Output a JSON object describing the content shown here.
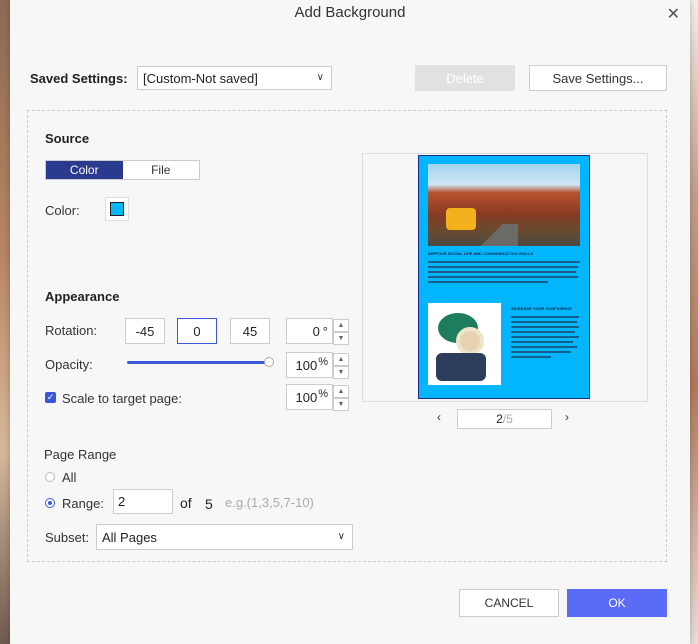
{
  "dialog": {
    "title": "Add Background"
  },
  "saved_settings": {
    "label": "Saved Settings:",
    "value": "[Custom-Not saved]",
    "delete_label": "Delete",
    "save_label": "Save Settings..."
  },
  "source": {
    "heading": "Source",
    "tabs": [
      "Color",
      "File"
    ],
    "active_tab": "Color",
    "color_label": "Color:",
    "color_value": "#00b7f7"
  },
  "appearance": {
    "heading": "Appearance",
    "rotation_label": "Rotation:",
    "rotation_options": [
      "-45",
      "0",
      "45"
    ],
    "rotation_selected": "0",
    "rotation_value": "0",
    "rotation_unit": "°",
    "opacity_label": "Opacity:",
    "opacity_value": "100",
    "opacity_unit": "%",
    "scale_label": "Scale to target page:",
    "scale_checked": true,
    "scale_value": "100",
    "scale_unit": "%"
  },
  "page_range": {
    "heading": "Page Range",
    "all_label": "All",
    "range_label": "Range:",
    "range_value": "2",
    "of_label": "of",
    "total_pages": "5",
    "example": "e.g.(1,3,5,7-10)",
    "subset_label": "Subset:",
    "subset_value": "All Pages"
  },
  "preview": {
    "prev_icon": "‹",
    "next_icon": "›",
    "current_page": "2",
    "total_suffix": "/5",
    "doc_heading1": "IMPROVE SOCIAL LIFE AND COMMUNICATION SKILLS",
    "doc_heading2": "INCREASE YOUR CONFIDENCE"
  },
  "footer": {
    "cancel_label": "CANCEL",
    "ok_label": "OK"
  },
  "colors": {
    "accent": "#5a6cf5",
    "segment_active": "#2a3a8f",
    "page_bg": "#01b5ff"
  }
}
